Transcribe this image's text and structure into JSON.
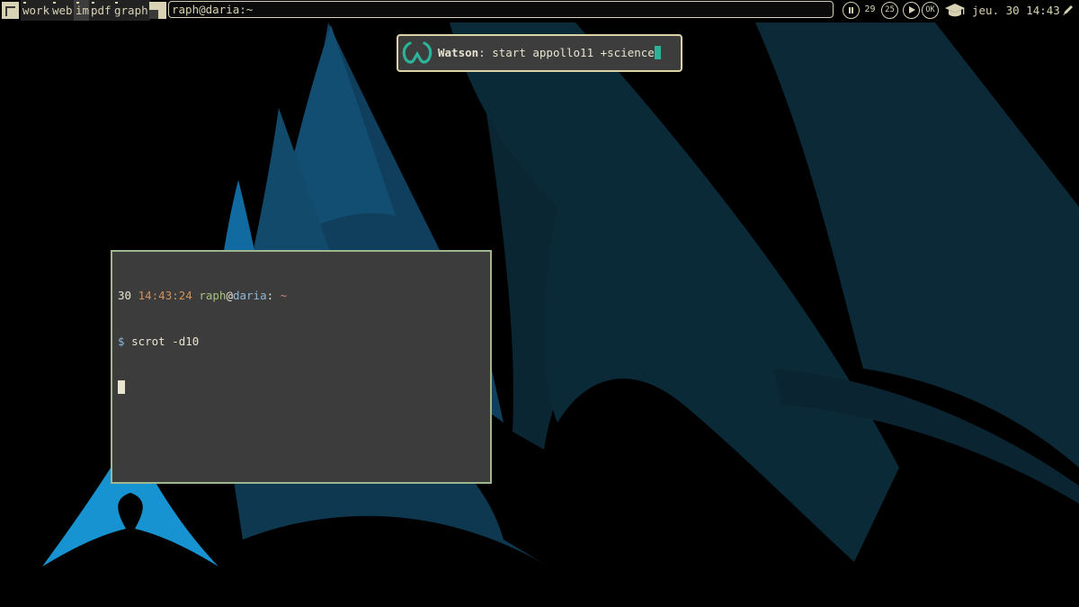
{
  "topbar": {
    "workspaces": [
      {
        "label": "work",
        "active": false
      },
      {
        "label": "web",
        "active": false
      },
      {
        "label": "im",
        "active": true
      },
      {
        "label": "pdf",
        "active": false
      },
      {
        "label": "graph",
        "active": false
      }
    ],
    "window_title": "raph@daria:~",
    "tray": {
      "badge_29": "29",
      "badge_25": "25",
      "ok": "OK"
    },
    "clock": "jeu. 30 14:43"
  },
  "watson": {
    "name": "Watson",
    "separator": ": ",
    "command": "start appollo11 +science"
  },
  "terminal": {
    "day": "30",
    "time": "14:43:24",
    "user": "raph",
    "at": "@",
    "host": "daria",
    "colon": ":",
    "path": "~",
    "prompt_symbol": "$",
    "command": "scrot -d10"
  },
  "colors": {
    "wallpaper_bright_blue": "#1793d1",
    "wallpaper_mid_blue": "#114c70",
    "wallpaper_dark_blue": "#0c2c3a",
    "bar_text": "#d7d2b4",
    "terminal_border": "#9eb68e",
    "watson_border": "#ddd4a6",
    "watson_accent": "#2bb39a"
  }
}
